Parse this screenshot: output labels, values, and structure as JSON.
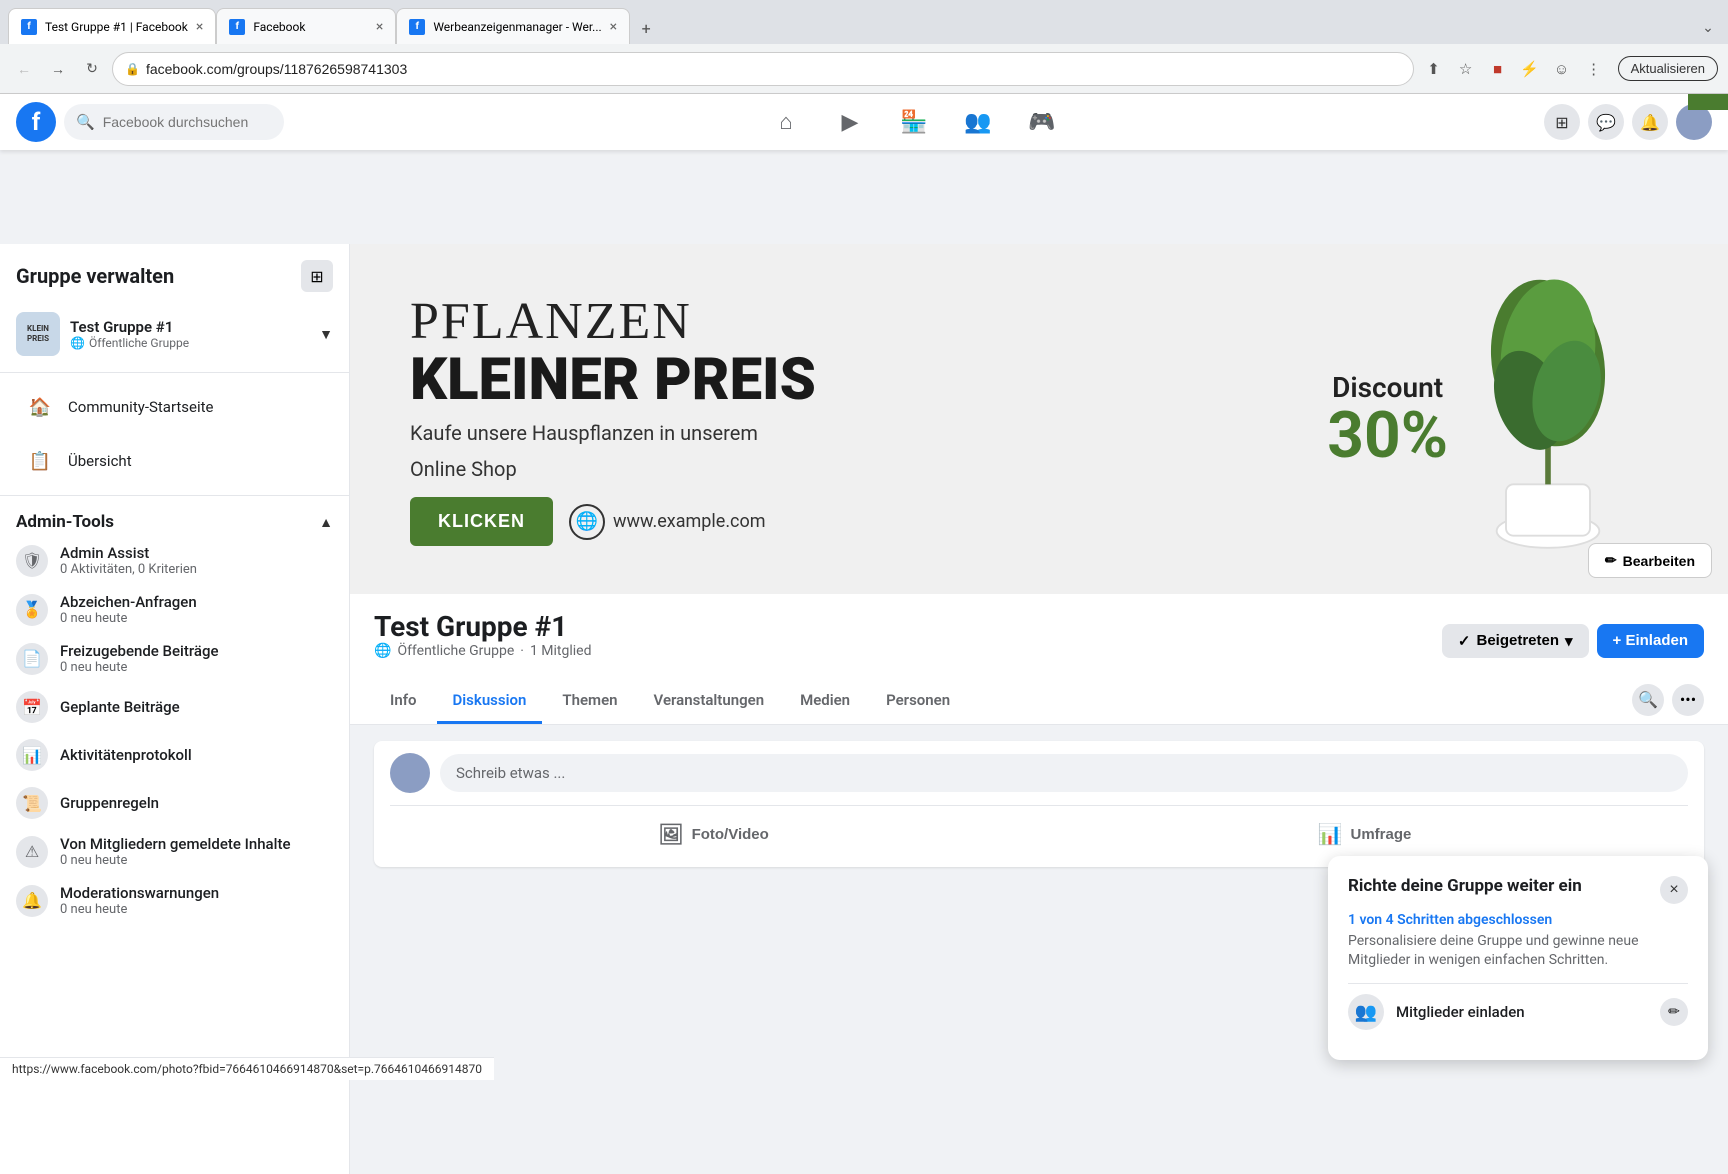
{
  "browser": {
    "tabs": [
      {
        "id": "tab1",
        "title": "Test Gruppe #1 | Facebook",
        "favicon": "fb",
        "active": true
      },
      {
        "id": "tab2",
        "title": "Facebook",
        "favicon": "fb",
        "active": false
      },
      {
        "id": "tab3",
        "title": "Werbeanzeigenmanager - Wer...",
        "favicon": "fb",
        "active": false
      }
    ],
    "address": "facebook.com/groups/11876265987413​03",
    "aktualisieren": "Aktualisieren"
  },
  "header": {
    "search_placeholder": "Facebook durchsuchen",
    "nav_icons": [
      "home",
      "video",
      "marketplace",
      "groups",
      "gaming"
    ],
    "right_icons": [
      "grid",
      "messenger",
      "bell",
      "avatar"
    ]
  },
  "sidebar": {
    "title": "Gruppe verwalten",
    "group_name": "Test Gruppe #1",
    "group_type": "Öffentliche Gruppe",
    "nav": [
      {
        "id": "community",
        "label": "Community-Startseite",
        "icon": "🏠"
      },
      {
        "id": "overview",
        "label": "Übersicht",
        "icon": "📋"
      }
    ],
    "admin_tools": {
      "title": "Admin-Tools",
      "items": [
        {
          "id": "admin-assist",
          "label": "Admin Assist",
          "sub": "0 Aktivitäten, 0 Kriterien"
        },
        {
          "id": "abzeichen",
          "label": "Abzeichen-Anfragen",
          "sub": "0 neu heute"
        },
        {
          "id": "freigabe",
          "label": "Freizugebende Beiträge",
          "sub": "0 neu heute"
        },
        {
          "id": "geplante",
          "label": "Geplante Beiträge",
          "sub": ""
        },
        {
          "id": "aktivitaet",
          "label": "Aktivitätenprotokoll",
          "sub": ""
        },
        {
          "id": "gruppenregeln",
          "label": "Gruppenregeln",
          "sub": ""
        },
        {
          "id": "gemeldete",
          "label": "Von Mitgliedern gemeldete Inhalte",
          "sub": "0 neu heute"
        },
        {
          "id": "moderations",
          "label": "Moderationswarnungen",
          "sub": "0 neu heute"
        }
      ]
    }
  },
  "cover": {
    "title": "PFLANZEN",
    "subtitle": "KLEINER PREIS",
    "description1": "Kaufe unsere Hauspflanzen in unserem",
    "description2": "Online Shop",
    "btn_label": "KLICKEN",
    "website": "www.example.com",
    "discount_label": "Discount",
    "discount_pct": "30%",
    "edit_btn": "Bearbeiten"
  },
  "group": {
    "name": "Test Gruppe #1",
    "type": "Öffentliche Gruppe",
    "members": "1 Mitglied",
    "btn_beigetreten": "Beigetreten",
    "btn_einladen": "+ Einladen",
    "tabs": [
      "Info",
      "Diskussion",
      "Themen",
      "Veranstaltungen",
      "Medien",
      "Personen"
    ],
    "active_tab": "Diskussion"
  },
  "post": {
    "placeholder": "Schreib etwas ...",
    "actions": [
      {
        "id": "foto",
        "label": "Foto/Video",
        "icon": "🖼"
      },
      {
        "id": "umfrage",
        "label": "Umfrage",
        "icon": "📊"
      }
    ]
  },
  "setup_panel": {
    "title": "Richte deine Gruppe weiter ein",
    "progress": "1 von 4 Schritten abgeschlossen",
    "description": "Personalisiere deine Gruppe und gewinne neue Mitglieder in wenigen einfachen Schritten.",
    "item_label": "Mitglieder einladen",
    "close_icon": "×",
    "edit_icon": "✏"
  },
  "status_bar": {
    "url": "https://www.facebook.com/photo?fbid=766461046691​4870&set=p.76646104669​14870"
  },
  "green_badge": ""
}
